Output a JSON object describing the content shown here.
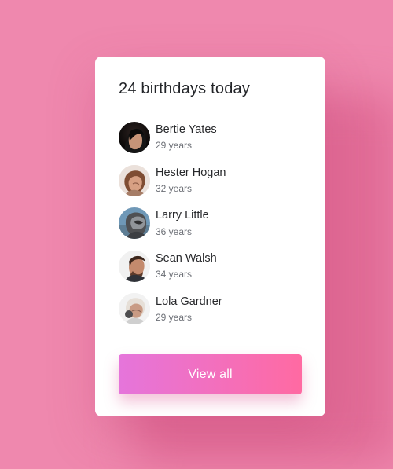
{
  "title": "24 birthdays today",
  "people": [
    {
      "name": "Bertie Yates",
      "age": "29 years",
      "avatar_icon": "portrait-photo"
    },
    {
      "name": "Hester Hogan",
      "age": "32 years",
      "avatar_icon": "portrait-photo"
    },
    {
      "name": "Larry Little",
      "age": "36 years",
      "avatar_icon": "helmet-photo"
    },
    {
      "name": "Sean Walsh",
      "age": "34 years",
      "avatar_icon": "portrait-photo"
    },
    {
      "name": "Lola Gardner",
      "age": "29 years",
      "avatar_icon": "portrait-photo"
    }
  ],
  "button_label": "View all",
  "colors": {
    "background": "#ef88ae",
    "card": "#ffffff",
    "button_start": "#e575db",
    "button_end": "#ff6aa2"
  }
}
